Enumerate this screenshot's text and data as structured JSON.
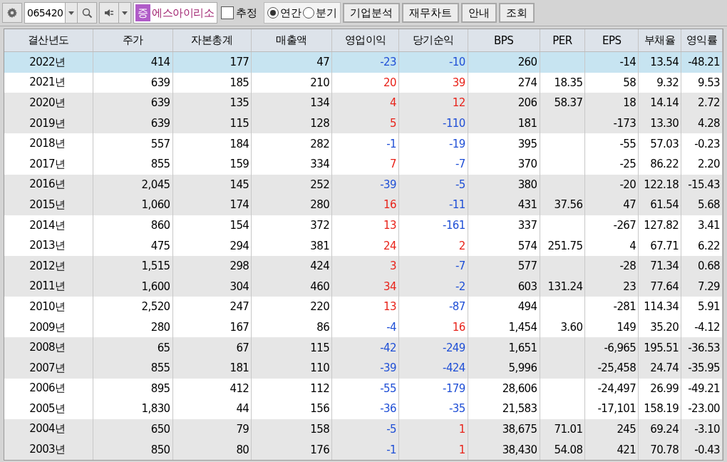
{
  "toolbar": {
    "code": "065420",
    "market_badge": "증",
    "company": "에스아이리소",
    "estimate": {
      "label": "추정",
      "checked": false
    },
    "periods": [
      {
        "label": "연간",
        "selected": true
      },
      {
        "label": "분기",
        "selected": false
      }
    ],
    "buttons": [
      "기업분석",
      "재무차트",
      "안내",
      "조회"
    ]
  },
  "table": {
    "columns": [
      "결산년도",
      "주가",
      "자본총계",
      "매출액",
      "영업이익",
      "당기순익",
      "BPS",
      "PER",
      "EPS",
      "부채율",
      "영익률"
    ],
    "rows": [
      {
        "selected": true,
        "cells": [
          "2022년",
          "414",
          "177",
          "47",
          {
            "text": "-23",
            "color": "#1f4fd6"
          },
          {
            "text": "-10",
            "color": "#1f4fd6"
          },
          "260",
          "",
          "-14",
          "13.54",
          "-48.21"
        ]
      },
      {
        "selected": false,
        "cells": [
          "2021년",
          "639",
          "185",
          "210",
          {
            "text": "20",
            "color": "#e8231a"
          },
          {
            "text": "39",
            "color": "#e8231a"
          },
          "274",
          "18.35",
          "58",
          "9.32",
          "9.53"
        ]
      },
      {
        "selected": false,
        "cells": [
          "2020년",
          "639",
          "135",
          "134",
          {
            "text": "4",
            "color": "#e8231a"
          },
          {
            "text": "12",
            "color": "#e8231a"
          },
          "206",
          "58.37",
          "18",
          "14.14",
          "2.72"
        ]
      },
      {
        "selected": false,
        "cells": [
          "2019년",
          "639",
          "115",
          "128",
          {
            "text": "5",
            "color": "#e8231a"
          },
          {
            "text": "-110",
            "color": "#1f4fd6"
          },
          "181",
          "",
          "-173",
          "13.30",
          "4.28"
        ]
      },
      {
        "selected": false,
        "cells": [
          "2018년",
          "557",
          "184",
          "282",
          {
            "text": "-1",
            "color": "#1f4fd6"
          },
          {
            "text": "-19",
            "color": "#1f4fd6"
          },
          "395",
          "",
          "-55",
          "57.03",
          "-0.23"
        ]
      },
      {
        "selected": false,
        "cells": [
          "2017년",
          "855",
          "159",
          "334",
          {
            "text": "7",
            "color": "#e8231a"
          },
          {
            "text": "-7",
            "color": "#1f4fd6"
          },
          "370",
          "",
          "-25",
          "86.22",
          "2.20"
        ]
      },
      {
        "selected": false,
        "cells": [
          "2016년",
          "2,045",
          "145",
          "252",
          {
            "text": "-39",
            "color": "#1f4fd6"
          },
          {
            "text": "-5",
            "color": "#1f4fd6"
          },
          "380",
          "",
          "-20",
          "122.18",
          "-15.43"
        ]
      },
      {
        "selected": false,
        "cells": [
          "2015년",
          "1,060",
          "174",
          "280",
          {
            "text": "16",
            "color": "#e8231a"
          },
          {
            "text": "-11",
            "color": "#1f4fd6"
          },
          "431",
          "37.56",
          "47",
          "61.54",
          "5.68"
        ]
      },
      {
        "selected": false,
        "cells": [
          "2014년",
          "860",
          "154",
          "372",
          {
            "text": "13",
            "color": "#e8231a"
          },
          {
            "text": "-161",
            "color": "#1f4fd6"
          },
          "337",
          "",
          "-267",
          "127.82",
          "3.41"
        ]
      },
      {
        "selected": false,
        "cells": [
          "2013년",
          "475",
          "294",
          "381",
          {
            "text": "24",
            "color": "#e8231a"
          },
          {
            "text": "2",
            "color": "#e8231a"
          },
          "574",
          "251.75",
          "4",
          "67.71",
          "6.22"
        ]
      },
      {
        "selected": false,
        "cells": [
          "2012년",
          "1,515",
          "298",
          "424",
          {
            "text": "3",
            "color": "#e8231a"
          },
          {
            "text": "-7",
            "color": "#1f4fd6"
          },
          "577",
          "",
          "-28",
          "71.34",
          "0.68"
        ]
      },
      {
        "selected": false,
        "cells": [
          "2011년",
          "1,600",
          "304",
          "460",
          {
            "text": "34",
            "color": "#e8231a"
          },
          {
            "text": "-2",
            "color": "#1f4fd6"
          },
          "603",
          "131.24",
          "23",
          "77.64",
          "7.29"
        ]
      },
      {
        "selected": false,
        "cells": [
          "2010년",
          "2,520",
          "247",
          "220",
          {
            "text": "13",
            "color": "#e8231a"
          },
          {
            "text": "-87",
            "color": "#1f4fd6"
          },
          "494",
          "",
          "-281",
          "114.34",
          "5.91"
        ]
      },
      {
        "selected": false,
        "cells": [
          "2009년",
          "280",
          "167",
          "86",
          {
            "text": "-4",
            "color": "#1f4fd6"
          },
          {
            "text": "16",
            "color": "#e8231a"
          },
          "1,454",
          "3.60",
          "149",
          "35.20",
          "-4.12"
        ]
      },
      {
        "selected": false,
        "cells": [
          "2008년",
          "65",
          "67",
          "115",
          {
            "text": "-42",
            "color": "#1f4fd6"
          },
          {
            "text": "-249",
            "color": "#1f4fd6"
          },
          "1,651",
          "",
          "-6,965",
          "195.51",
          "-36.53"
        ]
      },
      {
        "selected": false,
        "cells": [
          "2007년",
          "855",
          "181",
          "110",
          {
            "text": "-39",
            "color": "#1f4fd6"
          },
          {
            "text": "-424",
            "color": "#1f4fd6"
          },
          "5,996",
          "",
          "-25,458",
          "24.74",
          "-35.95"
        ]
      },
      {
        "selected": false,
        "cells": [
          "2006년",
          "895",
          "412",
          "112",
          {
            "text": "-55",
            "color": "#1f4fd6"
          },
          {
            "text": "-179",
            "color": "#1f4fd6"
          },
          "28,606",
          "",
          "-24,497",
          "26.99",
          "-49.21"
        ]
      },
      {
        "selected": false,
        "cells": [
          "2005년",
          "1,830",
          "44",
          "156",
          {
            "text": "-36",
            "color": "#1f4fd6"
          },
          {
            "text": "-35",
            "color": "#1f4fd6"
          },
          "21,583",
          "",
          "-17,101",
          "158.19",
          "-23.00"
        ]
      },
      {
        "selected": false,
        "cells": [
          "2004년",
          "650",
          "79",
          "158",
          {
            "text": "-5",
            "color": "#1f4fd6"
          },
          {
            "text": "1",
            "color": "#e8231a"
          },
          "38,675",
          "71.01",
          "245",
          "69.24",
          "-3.10"
        ]
      },
      {
        "selected": false,
        "cells": [
          "2003년",
          "850",
          "80",
          "176",
          {
            "text": "-1",
            "color": "#1f4fd6"
          },
          {
            "text": "1",
            "color": "#e8231a"
          },
          "38,430",
          "54.08",
          "421",
          "70.78",
          "-0.43"
        ]
      }
    ]
  }
}
